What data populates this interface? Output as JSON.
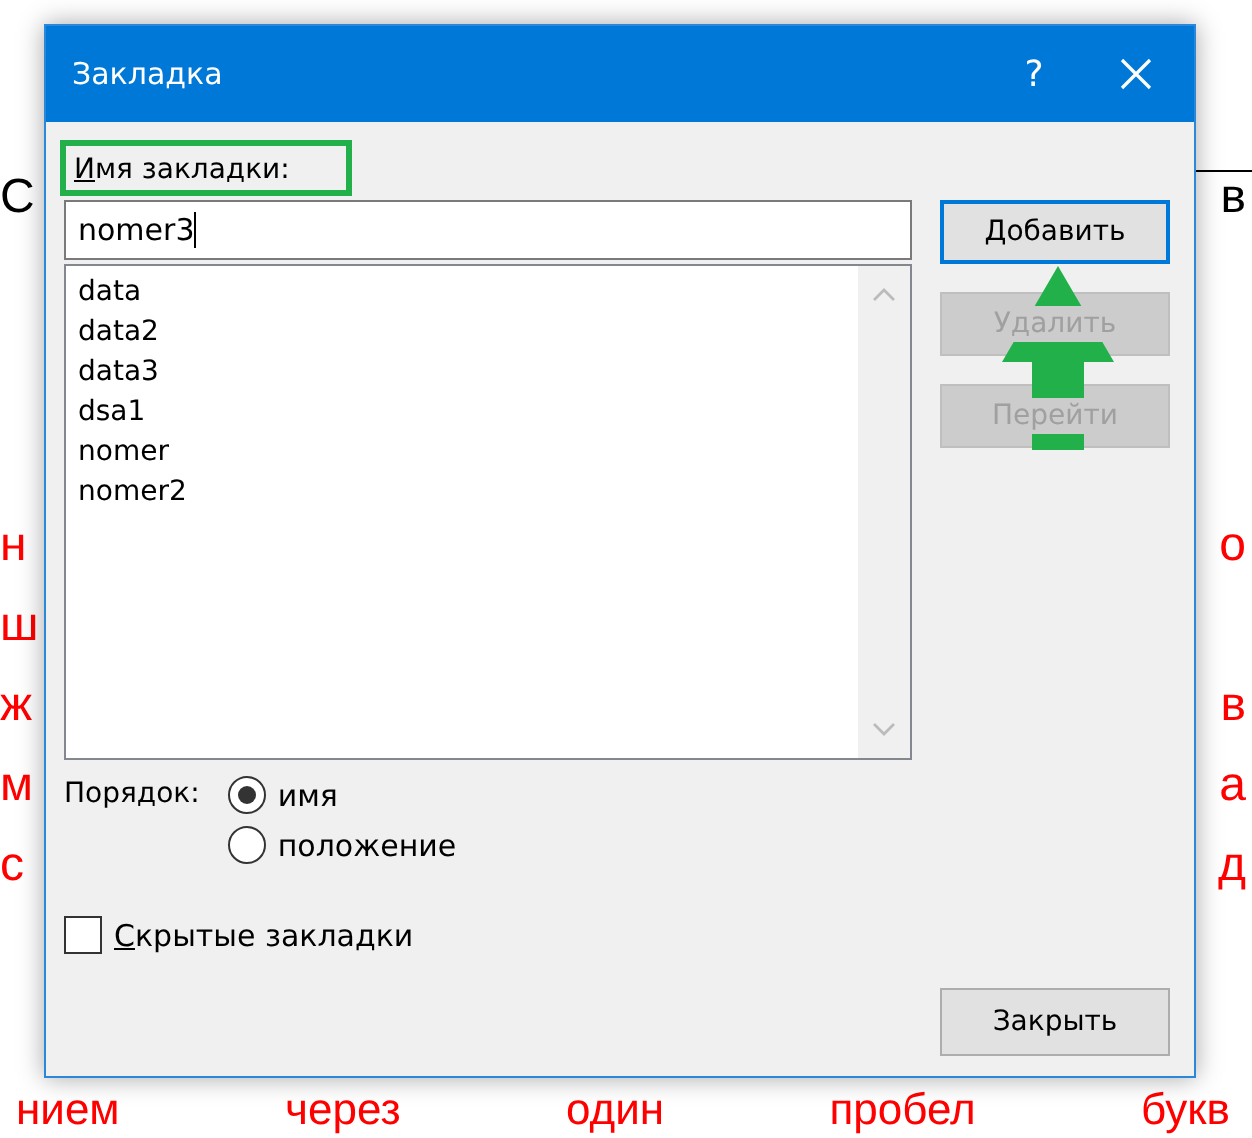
{
  "document": {
    "lines": [
      {
        "left": "С",
        "right": "в",
        "kind": "plain"
      },
      {
        "left": "н",
        "right": "о",
        "kind": "red"
      },
      {
        "left": "ш",
        "kind": "red"
      },
      {
        "left": "ж",
        "right": "в",
        "kind": "red"
      },
      {
        "left": "м",
        "right": "а",
        "kind": "red"
      },
      {
        "left": "с",
        "right": "д",
        "kind": "red"
      }
    ],
    "bottom_words": [
      "нием",
      "через",
      "один",
      "пробел",
      "букв"
    ]
  },
  "window": {
    "title": "Закладка",
    "help": "?"
  },
  "name_field": {
    "label": "Имя закладки:",
    "value": "nomer3",
    "highlighted": true
  },
  "bookmarks": [
    {
      "name": "data"
    },
    {
      "name": "data2"
    },
    {
      "name": "data3"
    },
    {
      "name": "dsa1"
    },
    {
      "name": "nomer"
    },
    {
      "name": "nomer2"
    }
  ],
  "buttons": [
    {
      "label": "Добавить",
      "disabled": false,
      "default": true
    },
    {
      "label": "Удалить",
      "disabled": true,
      "default": false
    },
    {
      "label": "Перейти",
      "disabled": true,
      "default": false
    }
  ],
  "order": {
    "label": "Порядок:",
    "options": [
      {
        "label": "имя",
        "selected": true
      },
      {
        "label": "положение",
        "selected": false
      }
    ]
  },
  "hidden_bookmarks": {
    "label": "Скрытые закладки",
    "checked": false
  },
  "close_button": "Закрыть",
  "annotation_arrow": true
}
